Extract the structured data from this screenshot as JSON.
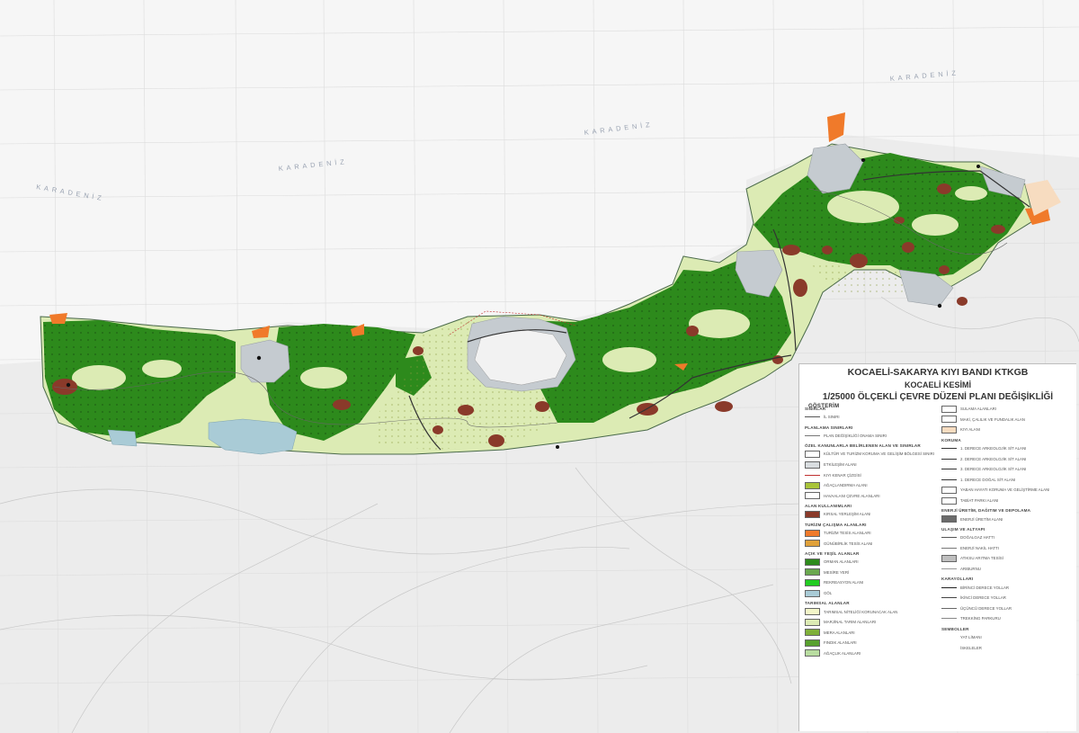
{
  "map": {
    "sea_labels": [
      "KARADENİZ",
      "KARADENİZ",
      "KARADENİZ",
      "KARADENİZ"
    ],
    "colors": {
      "sea": "#f4f4f4",
      "grid": "#d7d7d7",
      "land_base": "#eeeeee",
      "forest": "#2d8a1c",
      "pasture": "#dcebb4",
      "settlement": "#8a3a2a",
      "orange": "#f07a2a",
      "gray_area": "#bfc6cc",
      "lake": "#a9cbd6",
      "roads": "#555555"
    }
  },
  "legend": {
    "title": "KOCAELİ-SAKARYA KIYI BANDI KTKGB",
    "subtitle": "KOCAELİ KESİMİ",
    "plan_title": "1/25000 ÖLÇEKLİ ÇEVRE DÜZENİ PLANI DEĞİŞİKLİĞİ",
    "gosterim": "GÖSTERİM",
    "left": [
      {
        "type": "section",
        "text": "SINIRLAR"
      },
      {
        "type": "line",
        "text": "İL SINIRI",
        "color": "#555555"
      },
      {
        "type": "section",
        "text": "PLANLAMA SINIRLARI"
      },
      {
        "type": "line",
        "text": "PLAN DEĞİŞİKLİĞİ ONAMA SINIRI",
        "color": "#777777"
      },
      {
        "type": "section",
        "text": "ÖZEL KANUNLARLA BELİRLENEN ALAN VE SINIRLAR"
      },
      {
        "type": "swatch",
        "text": "KÜLTÜR VE TURİZM KORUMA VE GELİŞİM BÖLGESİ SINIRI",
        "color": "#ffffff"
      },
      {
        "type": "swatch",
        "text": "ETKİLEŞİM ALANI",
        "color": "#d9dde0"
      },
      {
        "type": "line",
        "text": "KIYI KENAR ÇİZGİSİ",
        "color": "#c03030"
      },
      {
        "type": "swatch",
        "text": "AĞAÇLANDIRMA ALANI",
        "color": "#a9c43a"
      },
      {
        "type": "swatch",
        "text": "HAVAALANI ÇEVRE ALANLARI",
        "color": "#ffffff"
      },
      {
        "type": "section",
        "text": "ALAN KULLANIMLARI"
      },
      {
        "type": "swatch",
        "text": "KIRSAL YERLEŞİM ALANI",
        "color": "#8a3a2a"
      },
      {
        "type": "section",
        "text": "TURİZM ÇALIŞMA ALANLARI"
      },
      {
        "type": "swatch",
        "text": "TURİZM TESİS ALANLARI",
        "color": "#f07a2a"
      },
      {
        "type": "swatch",
        "text": "GÜNÜBİRLİK TESİS ALANI",
        "color": "#e0a13a"
      },
      {
        "type": "section",
        "text": "AÇIK VE YEŞİL ALANLAR"
      },
      {
        "type": "swatch",
        "text": "ORMAN ALANLARI",
        "color": "#2d8a1c"
      },
      {
        "type": "swatch",
        "text": "MESİRE YERİ",
        "color": "#6aa84f"
      },
      {
        "type": "swatch",
        "text": "REKREASYON ALANI",
        "color": "#22cc22"
      },
      {
        "type": "swatch",
        "text": "GÖL",
        "color": "#a9cbd6"
      },
      {
        "type": "section",
        "text": "TARIMSAL ALANLAR"
      },
      {
        "type": "swatch",
        "text": "TARIMSAL NİTELİĞİ KORUNACAK ALAN",
        "color": "#f3f6c8"
      },
      {
        "type": "swatch",
        "text": "MARJİNAL TARIM ALANLARI",
        "color": "#dcebb4"
      },
      {
        "type": "swatch",
        "text": "MERA ALANLARI",
        "color": "#7fb03a"
      },
      {
        "type": "swatch",
        "text": "FINDIK ALANLARI",
        "color": "#58a02e"
      },
      {
        "type": "swatch",
        "text": "AĞAÇLIK ALANLARI",
        "color": "#b8dca0"
      }
    ],
    "right": [
      {
        "type": "swatch",
        "text": "SULAMA ALANLARI",
        "color": "#ffffff"
      },
      {
        "type": "swatch",
        "text": "MAKİ, ÇALILIK VE FUNDALIK ALAN",
        "color": "#ffffff"
      },
      {
        "type": "swatch",
        "text": "KIYI ALANI",
        "color": "#f7dcc0"
      },
      {
        "type": "section",
        "text": "KORUMA"
      },
      {
        "type": "line",
        "text": "1. DERECE ARKEOLOJİK SİT ALANI",
        "color": "#333333"
      },
      {
        "type": "line",
        "text": "2. DERECE ARKEOLOJİK SİT ALANI",
        "color": "#333333"
      },
      {
        "type": "line",
        "text": "3. DERECE ARKEOLOJİK SİT ALANI",
        "color": "#333333"
      },
      {
        "type": "line",
        "text": "1. DERECE DOĞAL SİT ALANI",
        "color": "#333333"
      },
      {
        "type": "swatch",
        "text": "YABAN HAYATI KORUMA VE GELİŞTİRME ALANI",
        "color": "#ffffff"
      },
      {
        "type": "swatch",
        "text": "TABİAT PARKI ALANI",
        "color": "#ffffff"
      },
      {
        "type": "section",
        "text": "ENERJİ ÜRETİM, DAĞITIM VE DEPOLAMA"
      },
      {
        "type": "swatch",
        "text": "ENERJİ ÜRETİM ALANI",
        "color": "#6b6b6b"
      },
      {
        "type": "section",
        "text": "ULAŞIM VE ALTYAPI"
      },
      {
        "type": "line",
        "text": "DOĞALGAZ HATTI",
        "color": "#555555"
      },
      {
        "type": "line",
        "text": "ENERJİ NAKİL HATTI",
        "color": "#777777"
      },
      {
        "type": "swatch",
        "text": "ATIKSU ARITMA TESİSİ",
        "color": "#bfbfbf"
      },
      {
        "type": "line",
        "text": "ARIBURNU",
        "color": "#999999"
      },
      {
        "type": "section",
        "text": "KARAYOLLARI"
      },
      {
        "type": "line",
        "text": "BİRİNCİ DERECE YOLLAR",
        "color": "#222222"
      },
      {
        "type": "line",
        "text": "İKİNCİ DERECE YOLLAR",
        "color": "#444444"
      },
      {
        "type": "line",
        "text": "ÜÇÜNCÜ DERECE YOLLAR",
        "color": "#666666"
      },
      {
        "type": "line",
        "text": "TREKKİNG PARKURU",
        "color": "#888888"
      },
      {
        "type": "section",
        "text": "SEMBOLLER"
      },
      {
        "type": "line",
        "text": "YAT LİMANI",
        "color": "#ffffff"
      },
      {
        "type": "line",
        "text": "İSKELELER",
        "color": "#ffffff"
      }
    ]
  }
}
